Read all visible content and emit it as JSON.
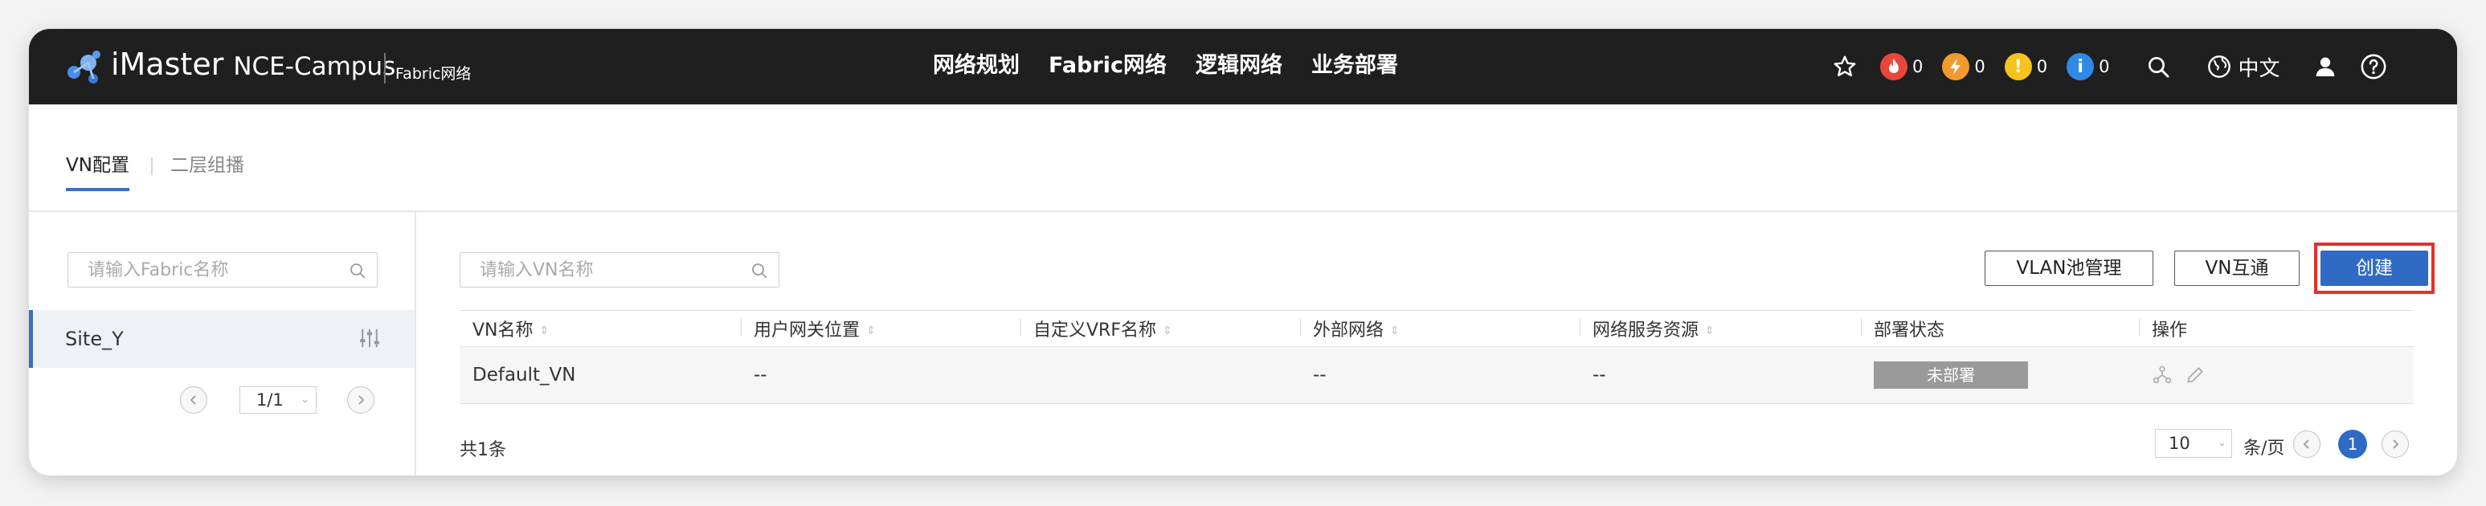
{
  "header": {
    "brand": "iMaster",
    "product": "NCE-Campus",
    "module": "Fabric网络",
    "nav": [
      "网络规划",
      "Fabric网络",
      "逻辑网络",
      "业务部署"
    ],
    "alarms": [
      {
        "name": "critical",
        "glyph": "🔥",
        "count": "0",
        "color": "#e8473c"
      },
      {
        "name": "major",
        "glyph": "⚡",
        "count": "0",
        "color": "#f29a2e"
      },
      {
        "name": "minor",
        "glyph": "!",
        "count": "0",
        "color": "#f5c31b"
      },
      {
        "name": "info",
        "glyph": "i",
        "count": "0",
        "color": "#2e8ae6"
      }
    ],
    "language": "中文",
    "icons": [
      "star-icon",
      "search-icon",
      "globe-icon",
      "user-icon",
      "help-icon"
    ]
  },
  "tabs": {
    "active": "VN配置",
    "inactive": "二层组播"
  },
  "sidebar": {
    "search_placeholder": "请输入Fabric名称",
    "items": [
      "Site_Y"
    ],
    "pager": {
      "page": "1/1"
    }
  },
  "main": {
    "search_placeholder": "请输入VN名称",
    "buttons": {
      "vlan_pool": "VLAN池管理",
      "vn_interconnect": "VN互通",
      "create": "创建"
    },
    "table": {
      "columns": [
        "VN名称",
        "用户网关位置",
        "自定义VRF名称",
        "外部网络",
        "网络服务资源",
        "部署状态",
        "操作"
      ],
      "rows": [
        {
          "vn_name": "Default_VN",
          "gateway": "--",
          "vrf": "",
          "external": "--",
          "service": "--",
          "status": "未部署"
        }
      ]
    },
    "footer": {
      "total": "共1条",
      "page_size": "10",
      "per_page_label": "条/页",
      "current_page": "1"
    }
  },
  "colors": {
    "topbar": "#1f1f1f",
    "accent": "#2f6bc4",
    "highlight": "#e5302a",
    "status_badge": "#9a9a9a"
  }
}
